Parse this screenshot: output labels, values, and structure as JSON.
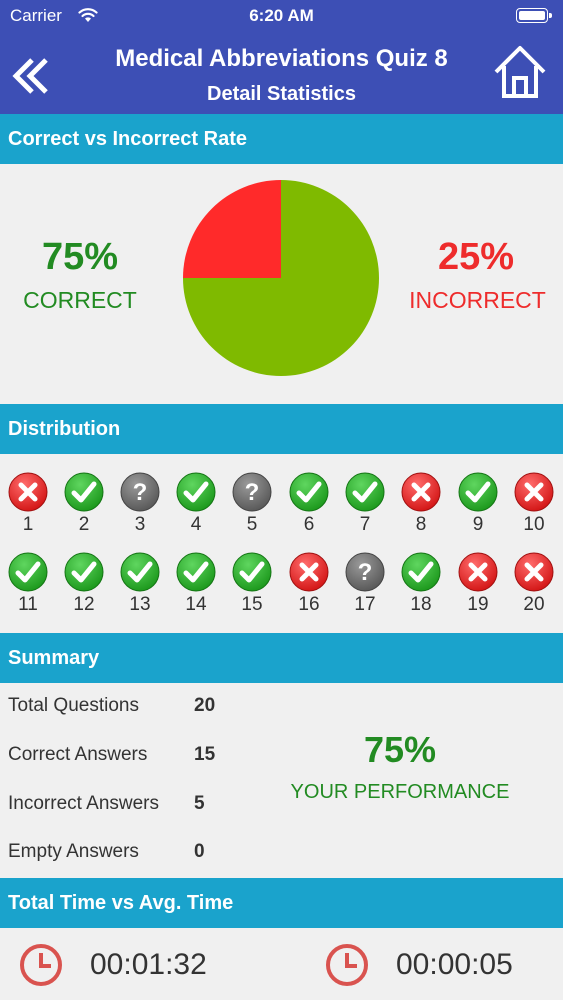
{
  "status_bar": {
    "carrier": "Carrier",
    "time": "6:20 AM"
  },
  "nav": {
    "title": "Medical Abbreviations Quiz 8",
    "subtitle": "Detail Statistics",
    "back_icon": "double-chevron-left-icon",
    "home_icon": "home-icon"
  },
  "rate": {
    "header": "Correct vs Incorrect Rate",
    "correct_pct": "75%",
    "correct_label": "CORRECT",
    "incorrect_pct": "25%",
    "incorrect_label": "INCORRECT",
    "colors": {
      "correct": "#7fba00",
      "incorrect": "#ff2a2a"
    }
  },
  "chart_data": {
    "type": "pie",
    "categories": [
      "Correct",
      "Incorrect"
    ],
    "values": [
      75,
      25
    ]
  },
  "distribution": {
    "header": "Distribution",
    "items": [
      {
        "n": "1",
        "status": "wrong"
      },
      {
        "n": "2",
        "status": "correct"
      },
      {
        "n": "3",
        "status": "empty"
      },
      {
        "n": "4",
        "status": "correct"
      },
      {
        "n": "5",
        "status": "empty"
      },
      {
        "n": "6",
        "status": "correct"
      },
      {
        "n": "7",
        "status": "correct"
      },
      {
        "n": "8",
        "status": "wrong"
      },
      {
        "n": "9",
        "status": "correct"
      },
      {
        "n": "10",
        "status": "wrong"
      },
      {
        "n": "11",
        "status": "correct"
      },
      {
        "n": "12",
        "status": "correct"
      },
      {
        "n": "13",
        "status": "correct"
      },
      {
        "n": "14",
        "status": "correct"
      },
      {
        "n": "15",
        "status": "correct"
      },
      {
        "n": "16",
        "status": "wrong"
      },
      {
        "n": "17",
        "status": "empty"
      },
      {
        "n": "18",
        "status": "correct"
      },
      {
        "n": "19",
        "status": "wrong"
      },
      {
        "n": "20",
        "status": "wrong"
      }
    ]
  },
  "summary": {
    "header": "Summary",
    "rows": [
      {
        "label": "Total Questions",
        "value": "20"
      },
      {
        "label": "Correct Answers",
        "value": "15"
      },
      {
        "label": "Incorrect Answers",
        "value": "5"
      },
      {
        "label": "Empty Answers",
        "value": "0"
      }
    ],
    "performance_pct": "75%",
    "performance_label": "YOUR PERFORMANCE"
  },
  "time": {
    "header": "Total Time vs Avg. Time",
    "total": "00:01:32",
    "average": "00:00:05",
    "icon": "clock-icon"
  }
}
